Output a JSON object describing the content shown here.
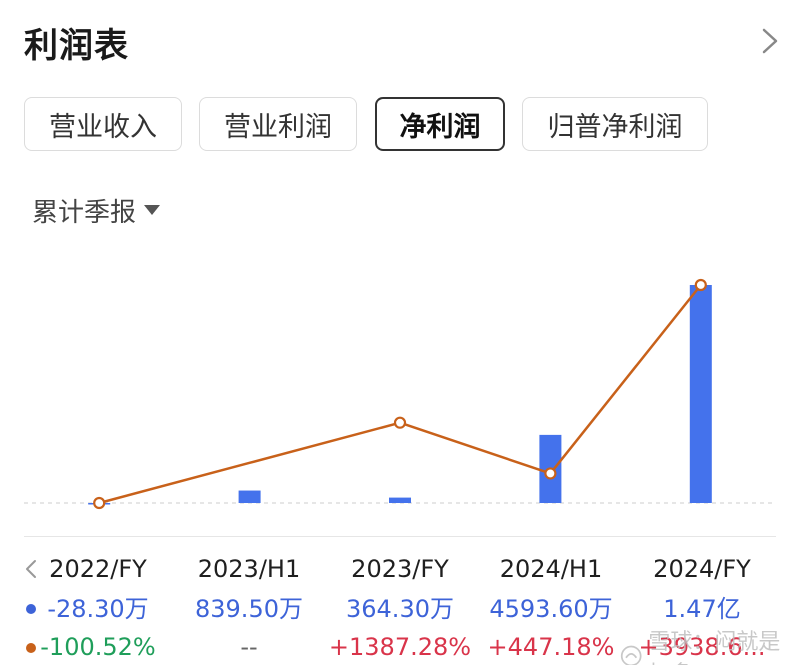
{
  "header": {
    "title": "利润表"
  },
  "tabs": [
    {
      "label": "营业收入",
      "active": false
    },
    {
      "label": "营业利润",
      "active": false
    },
    {
      "label": "净利润",
      "active": true
    },
    {
      "label": "归普净利润",
      "active": false
    }
  ],
  "period": {
    "label": "累计季报"
  },
  "colors": {
    "bar": "#4472ec",
    "line": "#c8611a",
    "profit_text": "#3d63d8",
    "negative": "#1f9e5a",
    "positive": "#d9344a"
  },
  "chart_data": {
    "type": "bar",
    "categories": [
      "2022/FY",
      "2023/H1",
      "2023/FY",
      "2024/H1",
      "2024/FY"
    ],
    "series": [
      {
        "values": [
          -28.3,
          839.5,
          364.3,
          4593.6,
          14700
        ]
      },
      {
        "values": [
          -100.52,
          null,
          1387.28,
          447.18,
          3938.6
        ]
      }
    ]
  },
  "table": {
    "periods": [
      "2022/FY",
      "2023/H1",
      "2023/FY",
      "2024/H1",
      "2024/FY"
    ],
    "profit": [
      "-28.30万",
      "839.50万",
      "364.30万",
      "4593.60万",
      "1.47亿"
    ],
    "growth": [
      "-100.52%",
      "--",
      "+1387.28%",
      "+447.18%",
      "+3938.6..."
    ]
  },
  "watermark": {
    "text": "雪球：闷就是加多"
  }
}
